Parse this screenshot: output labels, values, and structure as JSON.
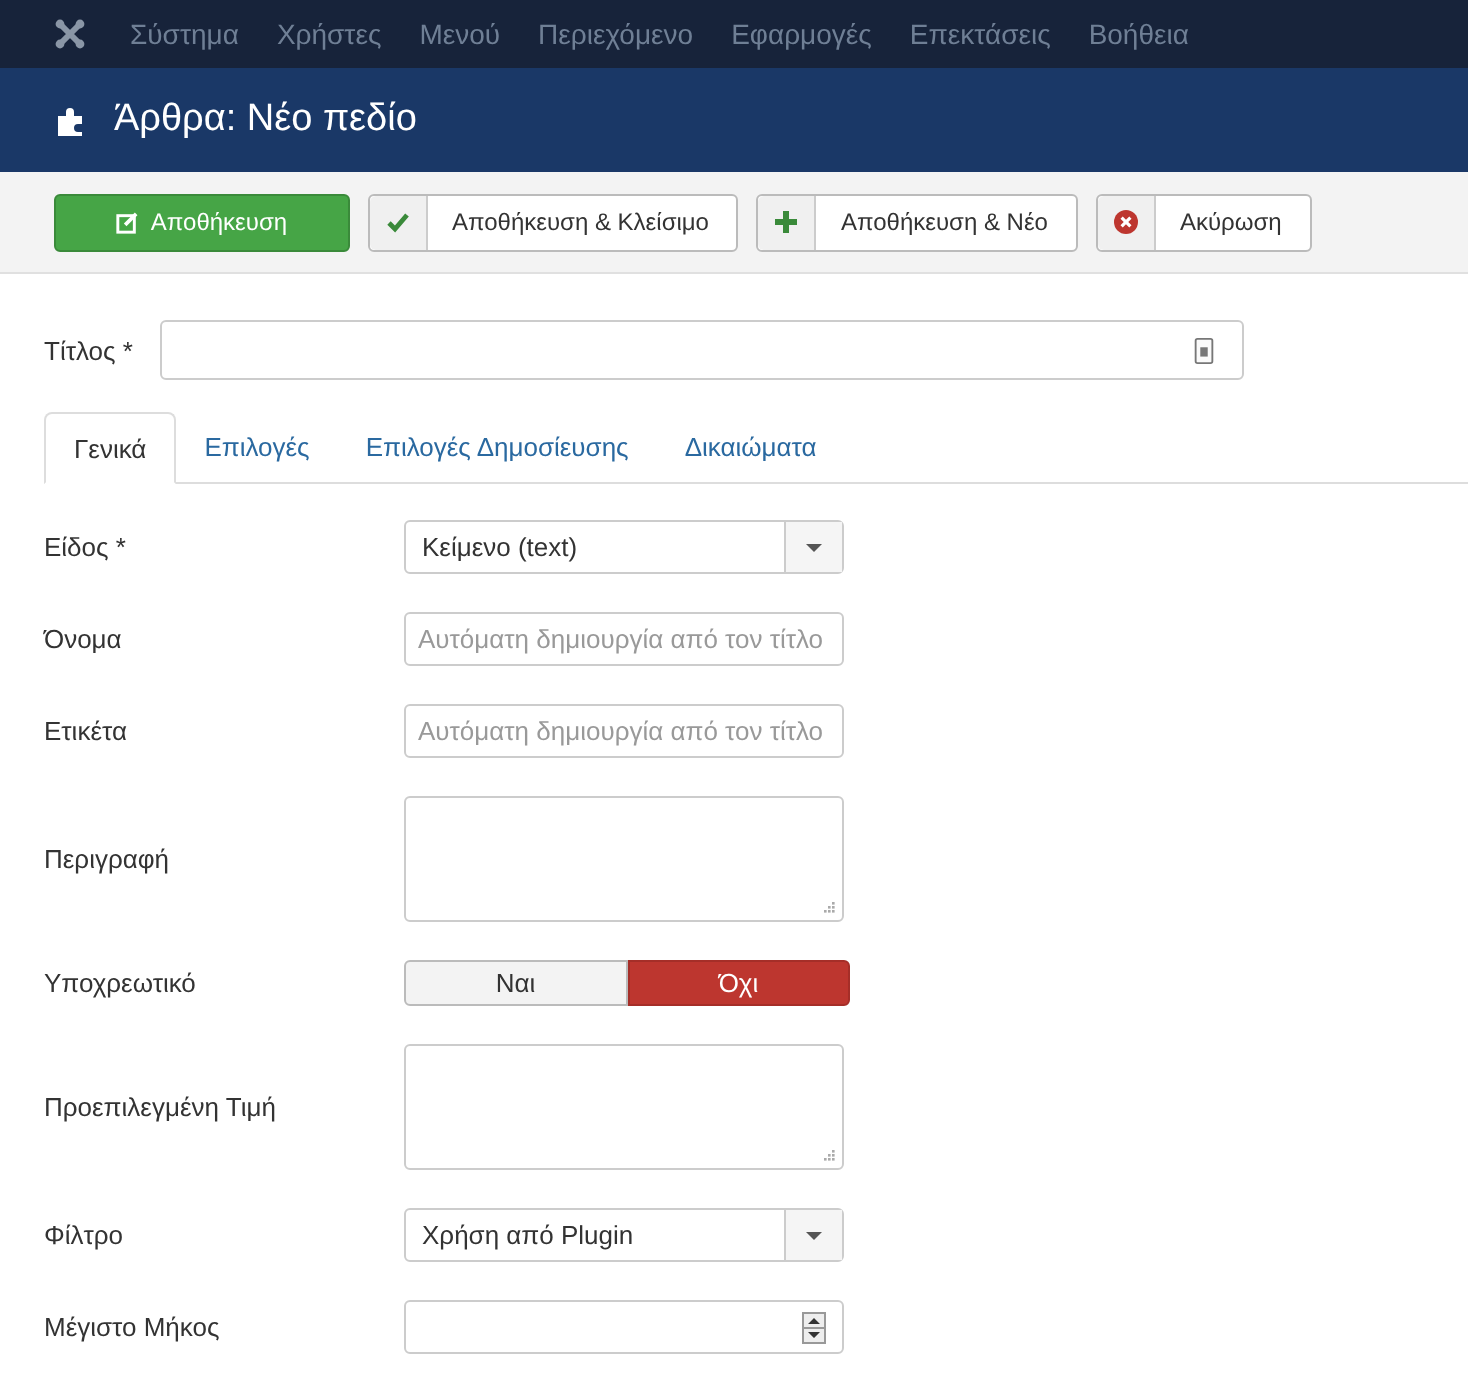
{
  "menu": [
    "Σύστημα",
    "Χρήστες",
    "Μενού",
    "Περιεχόμενο",
    "Εφαρμογές",
    "Επεκτάσεις",
    "Βοήθεια"
  ],
  "page_title": "Άρθρα: Νέο πεδίο",
  "toolbar": [
    {
      "label": "Αποθήκευση",
      "kind": "save"
    },
    {
      "label": "Αποθήκευση & Κλείσιμο",
      "kind": "save-close"
    },
    {
      "label": "Αποθήκευση & Νέο",
      "kind": "save-new"
    },
    {
      "label": "Ακύρωση",
      "kind": "cancel"
    }
  ],
  "title_field": {
    "label": "Τίτλος *"
  },
  "tabs": [
    {
      "label": "Γενικά",
      "selected": true
    },
    {
      "label": "Επιλογές",
      "selected": false
    },
    {
      "label": "Επιλογές Δημοσίευσης",
      "selected": false
    },
    {
      "label": "Δικαιώματα",
      "selected": false
    }
  ],
  "fields": [
    {
      "label": "Είδος *",
      "kind": "select",
      "value": "Κείμενο (text)"
    },
    {
      "label": "Όνομα",
      "kind": "text",
      "placeholder": "Αυτόματη δημιουργία από τον τίτλο"
    },
    {
      "label": "Ετικέτα",
      "kind": "text",
      "placeholder": "Αυτόματη δημιουργία από τον τίτλο"
    },
    {
      "label": "Περιγραφή",
      "kind": "textarea"
    },
    {
      "label": "Υποχρεωτικό",
      "kind": "toggle",
      "options": [
        {
          "label": "Ναι",
          "selected": false
        },
        {
          "label": "Όχι",
          "selected": true
        }
      ]
    },
    {
      "label": "Προεπιλεγμένη Τιμή",
      "kind": "textarea"
    },
    {
      "label": "Φίλτρο",
      "kind": "select",
      "value": "Χρήση από Plugin"
    },
    {
      "label": "Μέγιστο Μήκος",
      "kind": "number"
    }
  ]
}
